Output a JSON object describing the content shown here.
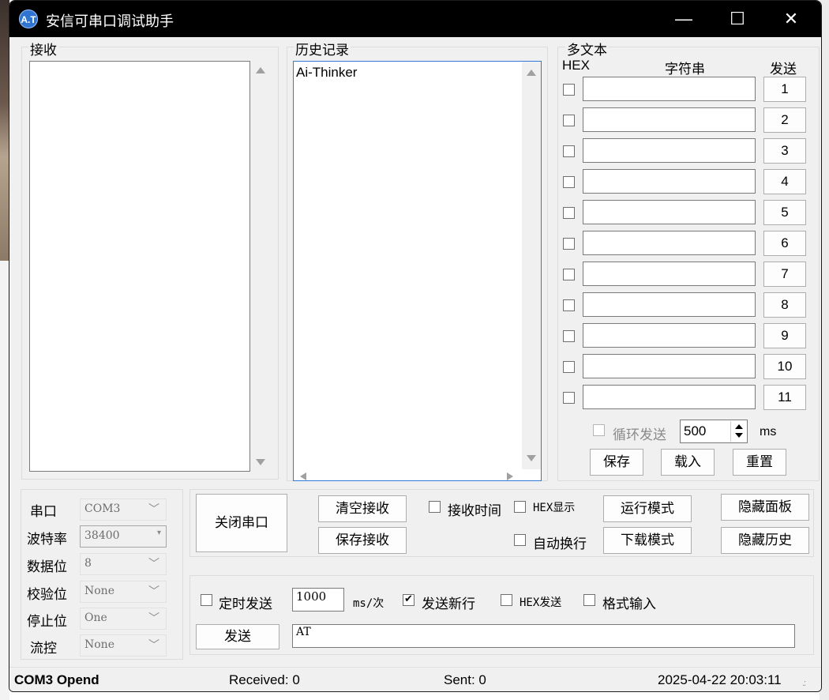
{
  "window": {
    "title": "安信可串口调试助手",
    "icon_text": "A.T",
    "controls": {
      "minimize": "—",
      "maximize": "☐",
      "close": "✕"
    }
  },
  "receive": {
    "label": "接收",
    "content": ""
  },
  "history": {
    "label": "历史记录",
    "items": [
      "Ai-Thinker"
    ]
  },
  "multi_text": {
    "label": "多文本",
    "col_hex": "HEX",
    "col_string": "字符串",
    "col_send": "发送",
    "rows": [
      {
        "n": "1",
        "value": ""
      },
      {
        "n": "2",
        "value": ""
      },
      {
        "n": "3",
        "value": ""
      },
      {
        "n": "4",
        "value": ""
      },
      {
        "n": "5",
        "value": ""
      },
      {
        "n": "6",
        "value": ""
      },
      {
        "n": "7",
        "value": ""
      },
      {
        "n": "8",
        "value": ""
      },
      {
        "n": "9",
        "value": ""
      },
      {
        "n": "10",
        "value": ""
      },
      {
        "n": "11",
        "value": ""
      }
    ],
    "loop_send_label": "循环发送",
    "loop_interval": "500",
    "loop_unit": "ms",
    "save": "保存",
    "load": "载入",
    "reset": "重置"
  },
  "port_settings": {
    "port_label": "串口",
    "port_value": "COM3",
    "baud_label": "波特率",
    "baud_value": "38400",
    "databits_label": "数据位",
    "databits_value": "8",
    "parity_label": "校验位",
    "parity_value": "None",
    "stopbits_label": "停止位",
    "stopbits_value": "One",
    "flow_label": "流控",
    "flow_value": "None"
  },
  "controls": {
    "close_port": "关闭串口",
    "clear_receive": "清空接收",
    "save_receive": "保存接收",
    "receive_time": "接收时间",
    "hex_display": "HEX显示",
    "auto_wrap": "自动换行",
    "run_mode": "运行模式",
    "download_mode": "下载模式",
    "hide_panel": "隐藏面板",
    "hide_history": "隐藏历史"
  },
  "send": {
    "timed_send": "定时发送",
    "interval": "1000",
    "interval_unit": "ms/次",
    "send_newline": "发送新行",
    "send_newline_checked": true,
    "hex_send": "HEX发送",
    "format_input": "格式输入",
    "send_button": "发送",
    "input_value": "AT"
  },
  "statusbar": {
    "port_status": "COM3 Opend",
    "received": "Received: 0",
    "sent": "Sent: 0",
    "datetime": "2025-04-22 20:03:11"
  }
}
